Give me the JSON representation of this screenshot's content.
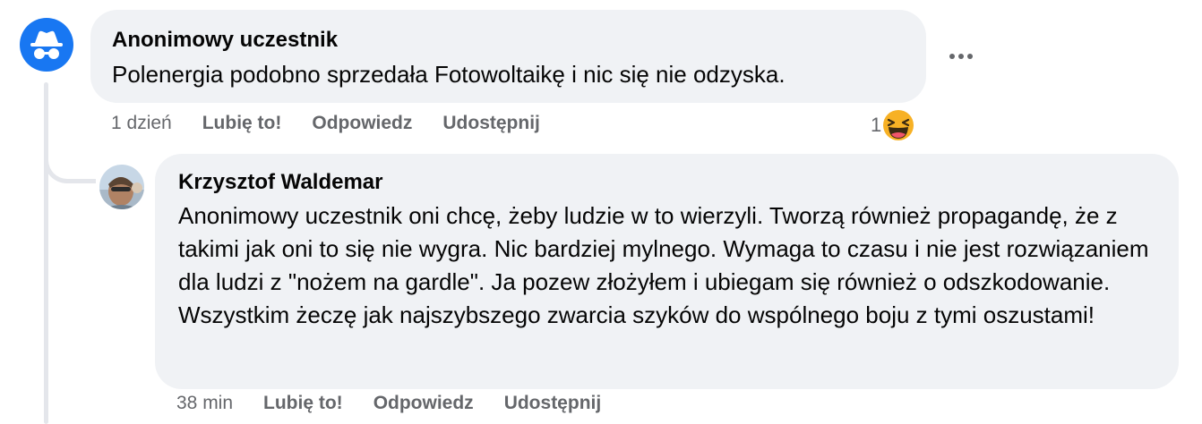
{
  "comments": [
    {
      "author": "Anonimowy uczestnik",
      "avatar_icon": "incognito-icon",
      "text": "Polenergia podobno sprzedała Fotowoltaikę i nic się nie odzyska.",
      "time": "1 dzień",
      "like_label": "Lubię to!",
      "reply_label": "Odpowiedz",
      "share_label": "Udostępnij",
      "reaction_count": "1",
      "reaction_icon": "laughing-emoji-icon"
    },
    {
      "author": "Krzysztof Waldemar",
      "text": "Anonimowy uczestnik oni chcę, żeby ludzie w to wierzyli. Tworzą również propagandę, że z takimi jak oni to się nie wygra. Nic bardziej mylnego. Wymaga to czasu i nie jest rozwiązaniem dla ludzi z \"nożem na gardle\". Ja pozew złożyłem i ubiegam się również o odszkodowanie. Wszystkim żeczę jak najszybszego zwarcia szyków do wspólnego boju z tymi oszustami!",
      "time": "38 min",
      "like_label": "Lubię to!",
      "reply_label": "Odpowiedz",
      "share_label": "Udostępnij"
    }
  ],
  "colors": {
    "bubble": "#f0f2f5",
    "meta_text": "#65676b",
    "anon_avatar_bg": "#1877f2",
    "thread_line": "#e4e6eb"
  },
  "more_icon": "more-horizontal-icon"
}
